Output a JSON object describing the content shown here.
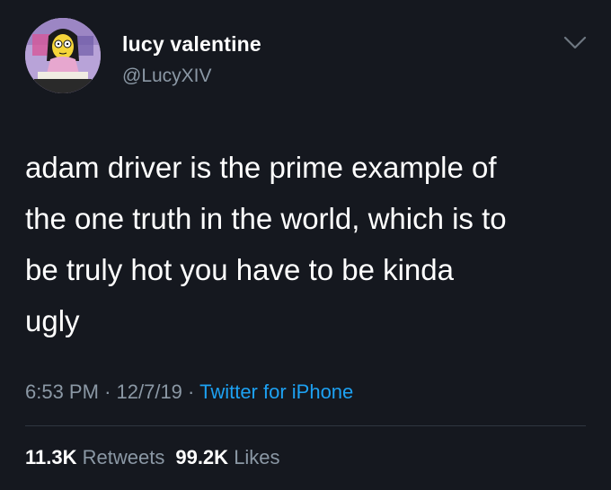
{
  "user": {
    "display_name": "lucy valentine",
    "handle": "@LucyXIV"
  },
  "tweet": {
    "lines": [
      "adam driver is the prime example of",
      "the one truth in the world, which is to",
      "be truly hot you have to be kinda",
      "ugly"
    ],
    "time": "6:53 PM",
    "date": "12/7/19",
    "separator": "·",
    "source": "Twitter for iPhone"
  },
  "stats": {
    "retweets_count": "11.3K",
    "retweets_label": "Retweets",
    "likes_count": "99.2K",
    "likes_label": "Likes"
  },
  "colors": {
    "background": "#15181f",
    "secondary_text": "#8b98a5",
    "link": "#1da1f2"
  },
  "icons": {
    "menu": "chevron-down-icon"
  }
}
